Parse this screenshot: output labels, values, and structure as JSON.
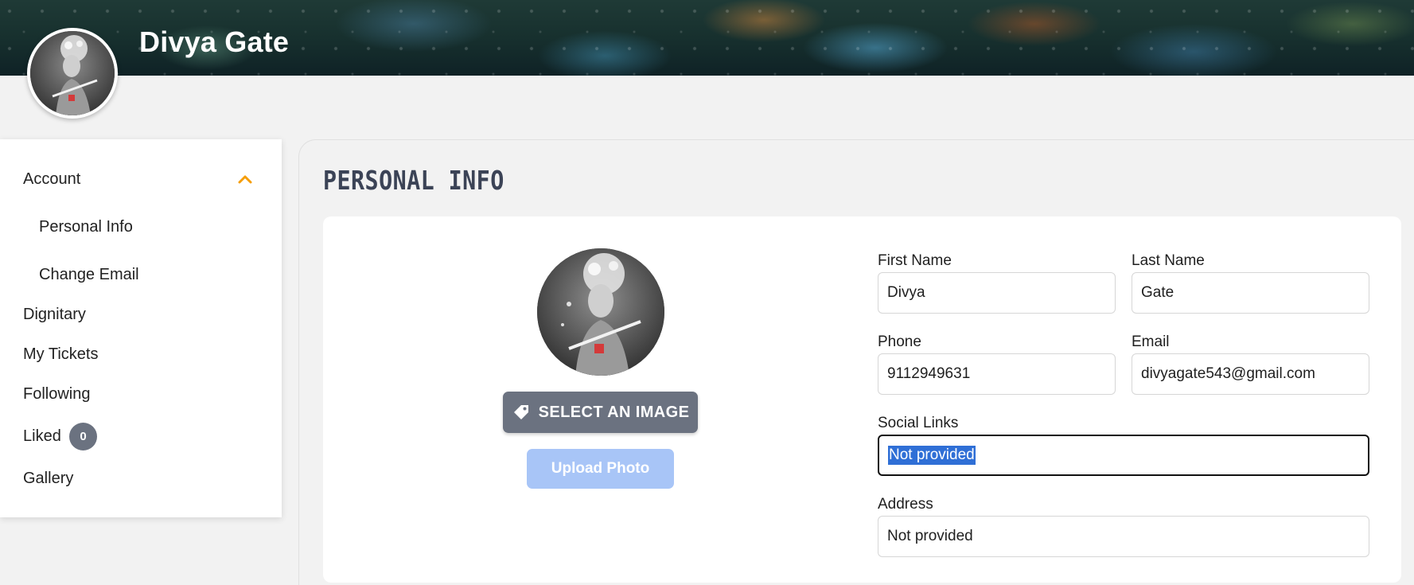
{
  "header": {
    "user_name": "Divya Gate"
  },
  "sidebar": {
    "items": [
      {
        "label": "Account"
      },
      {
        "label": "Personal Info"
      },
      {
        "label": "Change Email"
      },
      {
        "label": "Dignitary"
      },
      {
        "label": "My Tickets"
      },
      {
        "label": "Following"
      },
      {
        "label": "Liked",
        "badge": "0"
      },
      {
        "label": "Gallery"
      }
    ],
    "accent_color": "#f59e0b"
  },
  "main": {
    "title": "PERSONAL INFO",
    "select_image_label": "SELECT AN IMAGE",
    "upload_photo_label": "Upload Photo",
    "fields": {
      "first_name": {
        "label": "First Name",
        "value": "Divya"
      },
      "last_name": {
        "label": "Last Name",
        "value": "Gate"
      },
      "phone": {
        "label": "Phone",
        "value": "9112949631"
      },
      "email": {
        "label": "Email",
        "value": "divyagate543@gmail.com"
      },
      "social_links": {
        "label": "Social Links",
        "value": "Not provided"
      },
      "address": {
        "label": "Address",
        "value": "Not provided"
      }
    }
  }
}
